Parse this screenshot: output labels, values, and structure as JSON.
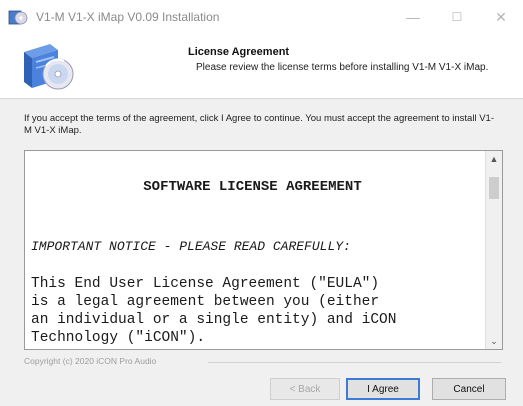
{
  "window": {
    "title": "V1-M V1-X iMap V0.09 Installation",
    "minimize_glyph": "—",
    "maximize_glyph": "☐",
    "close_glyph": "✕"
  },
  "header": {
    "title": "License Agreement",
    "subtitle": "Please review the license terms before installing V1-M V1-X iMap."
  },
  "instructions": "If you accept the terms of the agreement, click I Agree to continue. You must accept the agreement to install V1-M V1-X iMap.",
  "license": {
    "heading": "SOFTWARE LICENSE AGREEMENT",
    "notice": "IMPORTANT NOTICE - PLEASE READ CAREFULLY:",
    "body": "This End User License Agreement (\"EULA\")\nis a legal agreement between you (either\nan individual or a single entity) and iCON\nTechnology (\"iCON\")."
  },
  "scrollbar": {
    "up_glyph": "▲",
    "down_glyph": "⌄"
  },
  "branding": "Copyright (c) 2020 iCON Pro Audio",
  "buttons": {
    "back": "< Back",
    "agree": "I Agree",
    "cancel": "Cancel"
  },
  "colors": {
    "focus_border": "#3e7bd6",
    "header_bg": "#ffffff",
    "window_bg": "#f0f0f0"
  },
  "icons": {
    "app": "installer-cd-icon",
    "header": "software-box-cd-icon"
  }
}
